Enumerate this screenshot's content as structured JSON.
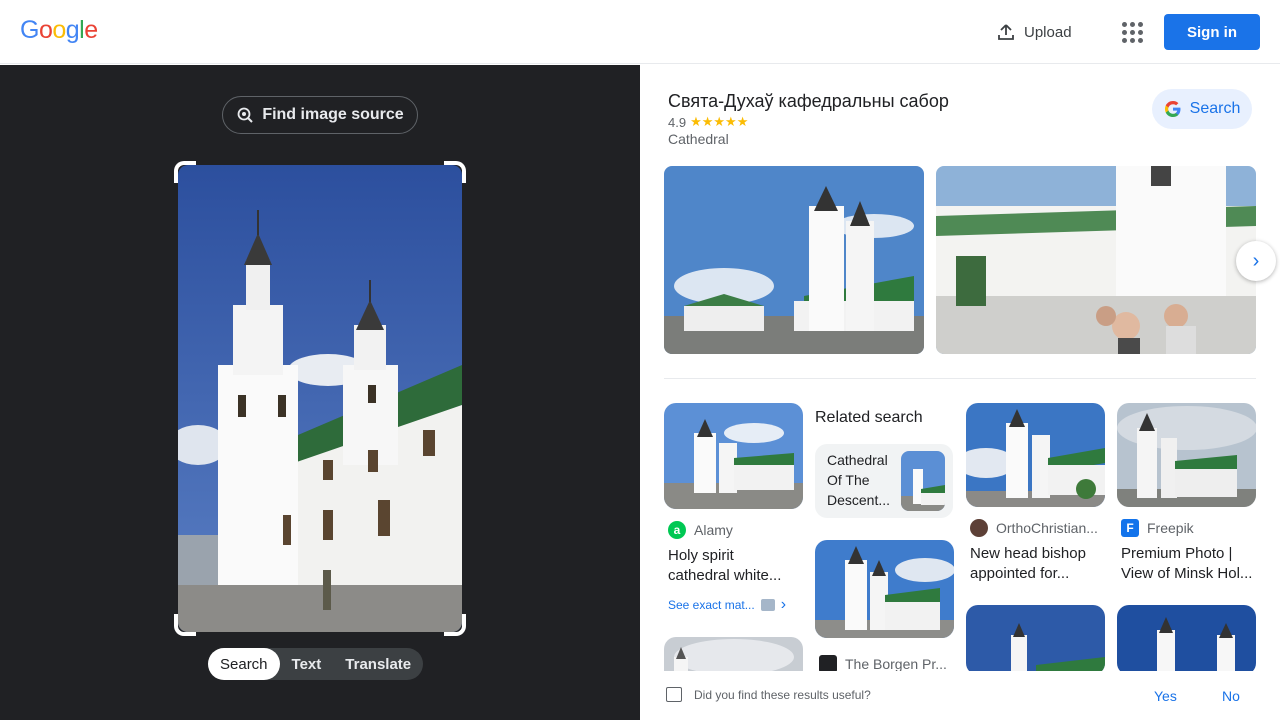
{
  "header": {
    "logo_letters": [
      "G",
      "o",
      "o",
      "g",
      "l",
      "e"
    ],
    "logo_colors": [
      "#4285f4",
      "#ea4335",
      "#fbbc05",
      "#4285f4",
      "#34a853",
      "#ea4335"
    ],
    "upload_label": "Upload",
    "signin_label": "Sign in"
  },
  "left": {
    "find_source_label": "Find image source",
    "tabs": [
      {
        "label": "Search",
        "active": true
      },
      {
        "label": "Text",
        "active": false
      },
      {
        "label": "Translate",
        "active": false
      }
    ]
  },
  "knowledge_panel": {
    "title": "Свята-Духаў кафедральны сабор",
    "rating": "4.9",
    "stars": "★★★★★",
    "type": "Cathedral",
    "search_label": "Search"
  },
  "results": [
    {
      "source": "Alamy",
      "source_icon": "a",
      "source_color": "#00c853",
      "title": "Holy spirit cathedral white..."
    },
    {
      "source": "OrthoChristian...",
      "source_icon": "",
      "source_color": "#5d4037",
      "title": "New head bishop appointed for..."
    },
    {
      "source": "Freepik",
      "source_icon": "F",
      "source_color": "#1273eb",
      "title": "Premium Photo | View of Minsk Hol..."
    },
    {
      "source": "The Borgen Pr...",
      "source_icon": "",
      "source_color": "#202124",
      "title": ""
    }
  ],
  "exact_matches_label": "See exact mat...",
  "related": {
    "heading": "Related search",
    "card_text": "Cathedral Of The Descent..."
  },
  "feedback": {
    "question": "Did you find these results useful?",
    "yes": "Yes",
    "no": "No"
  },
  "colors": {
    "accent": "#1a73e8",
    "dark_bg": "#202124"
  }
}
